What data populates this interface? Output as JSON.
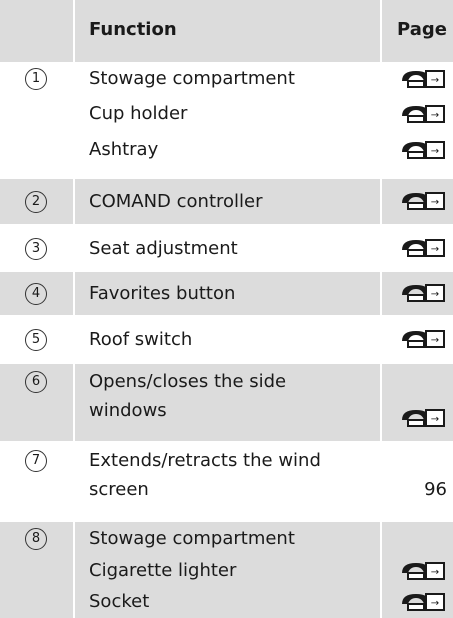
{
  "header": {
    "function_label": "Function",
    "page_label": "Page"
  },
  "rows": [
    {
      "number": "1",
      "lines": [
        "Stowage compartment",
        "Cup holder",
        "Ashtray"
      ]
    },
    {
      "number": "2",
      "lines": [
        "COMAND controller"
      ]
    },
    {
      "number": "3",
      "lines": [
        "Seat adjustment"
      ]
    },
    {
      "number": "4",
      "lines": [
        "Favorites button"
      ]
    },
    {
      "number": "5",
      "lines": [
        "Roof switch"
      ]
    },
    {
      "number": "6",
      "lines": [
        "Opens/closes the side",
        "windows"
      ]
    },
    {
      "number": "7",
      "lines": [
        "Extends/retracts the wind",
        "screen"
      ],
      "page": "96"
    },
    {
      "number": "8",
      "lines": [
        "Stowage compartment",
        "Cigarette lighter",
        "Socket"
      ]
    }
  ],
  "icons": {
    "page_ref": "page-reference-icon"
  },
  "colors": {
    "shade": "#dcdcdc",
    "text": "#1a1a1a"
  }
}
